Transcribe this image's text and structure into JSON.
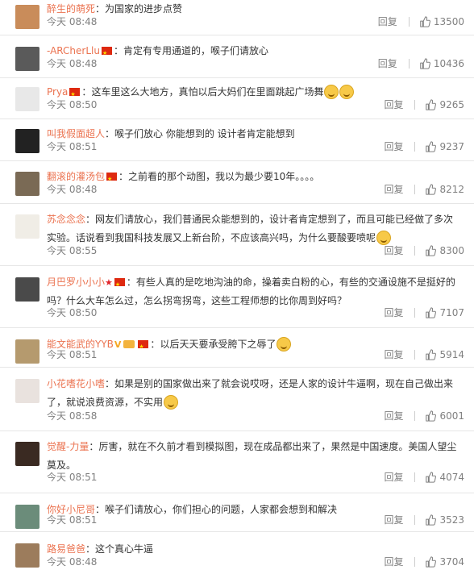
{
  "reply_label": "回复",
  "comments": [
    {
      "user": "醉生的萌死",
      "text": "为国家的进步点赞",
      "time": "今天 08:48",
      "likes": "13500",
      "badges": [],
      "emoji": 0
    },
    {
      "user": "-ARCherLlu",
      "text": "肯定有专用通道的，喉子们请放心",
      "time": "今天 08:48",
      "likes": "10436",
      "badges": [
        "flag"
      ],
      "emoji": 0
    },
    {
      "user": "Prya",
      "text": "这车里这么大地方，真怕以后大妈们在里面跳起广场舞",
      "time": "今天 08:50",
      "likes": "9265",
      "badges": [
        "flag"
      ],
      "emoji": 2
    },
    {
      "user": "叫我假面超人",
      "text": "喉子们放心 你能想到的 设计者肯定能想到",
      "time": "今天 08:51",
      "likes": "9237",
      "badges": [],
      "emoji": 0
    },
    {
      "user": "翻滚的灌汤包",
      "text": "之前看的那个动图，我以为最少要10年。。。。",
      "time": "今天 08:48",
      "likes": "8212",
      "badges": [
        "flag"
      ],
      "emoji": 0
    },
    {
      "user": "苏念念念",
      "text": "网友们请放心，我们普通民众能想到的，设计者肯定想到了，而且可能已经做了多次实验。话说看到我国科技发展又上新台阶，不应该高兴吗，为什么要酸要喷呢",
      "time": "今天 08:55",
      "likes": "8300",
      "badges": [],
      "emoji": 1
    },
    {
      "user": "月巴罗小小小",
      "text": "有些人真的是吃地沟油的命，操着卖白粉的心，有些的交通设施不是挺好的吗？什么大车怎么过，怎么拐弯拐弯，这些工程师想的比你周到好吗？",
      "time": "今天 08:50",
      "likes": "7107",
      "badges": [
        "star",
        "flag"
      ],
      "emoji": 0
    },
    {
      "user": "能文能武的YYB",
      "text": "以后天天要承受胯下之辱了",
      "time": "今天 08:51",
      "likes": "5914",
      "badges": [
        "vip",
        "medal",
        "flag"
      ],
      "emoji": 1
    },
    {
      "user": "小花嗜花小嗜",
      "text": "如果是别的国家做出来了就会说哎呀，还是人家的设计牛逼啊，现在自己做出来了，就说浪费资源，不实用",
      "time": "今天 08:58",
      "likes": "6001",
      "badges": [],
      "emoji": 1
    },
    {
      "user": "觉醒-力量",
      "text": "厉害，就在不久前才看到模拟图，现在成品都出来了，果然是中国速度。美国人望尘莫及。",
      "time": "今天 08:51",
      "likes": "4074",
      "badges": [],
      "emoji": 0
    },
    {
      "user": "你好小尼哥",
      "text": "喉子们请放心，你们担心的问题，人家都会想到和解决",
      "time": "今天 08:51",
      "likes": "3523",
      "badges": [],
      "emoji": 0
    },
    {
      "user": "路易爸爸",
      "text": "这个真心牛逼",
      "time": "今天 08:48",
      "likes": "3704",
      "badges": [],
      "emoji": 0
    }
  ],
  "colors": {
    "username": "#eb7350",
    "meta": "#808080",
    "text": "#333333"
  }
}
